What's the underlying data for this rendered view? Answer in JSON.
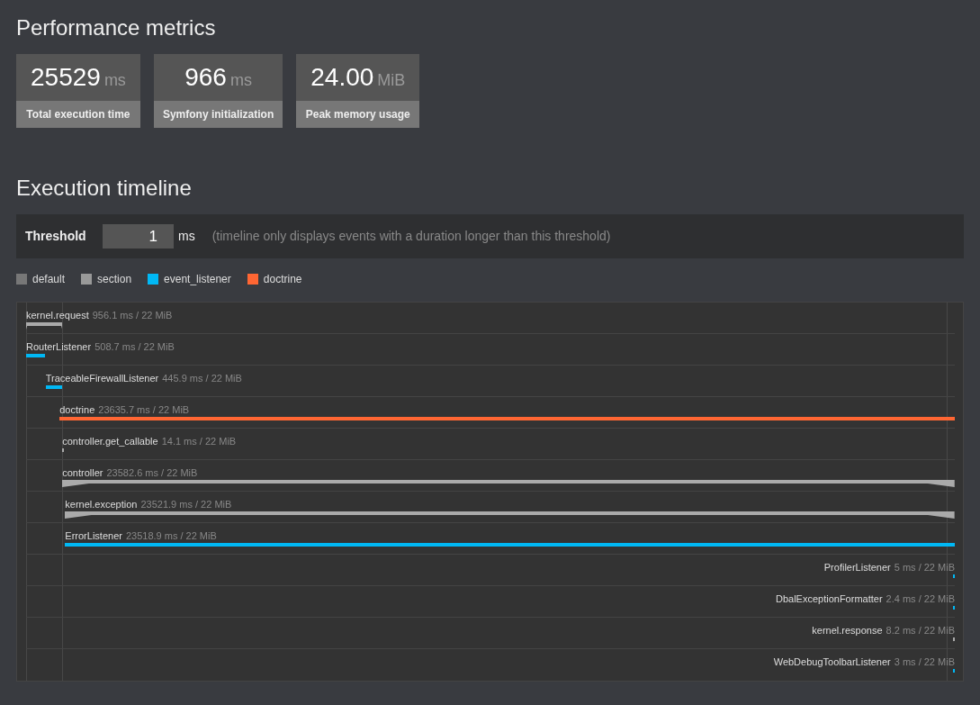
{
  "metrics_title": "Performance metrics",
  "metrics": [
    {
      "value": "25529",
      "unit": "ms",
      "label": "Total execution time"
    },
    {
      "value": "966",
      "unit": "ms",
      "label": "Symfony initialization"
    },
    {
      "value": "24.00",
      "unit": "MiB",
      "label": "Peak memory usage"
    }
  ],
  "timeline_title": "Execution timeline",
  "threshold": {
    "label": "Threshold",
    "value": "1",
    "unit": "ms",
    "hint": "(timeline only displays events with a duration longer than this threshold)"
  },
  "legend": [
    {
      "label": "default",
      "color": "#777777"
    },
    {
      "label": "section",
      "color": "#999999"
    },
    {
      "label": "event_listener",
      "color": "#00b8f5"
    },
    {
      "label": "doctrine",
      "color": "#ff6633"
    }
  ],
  "events": [
    {
      "name": "kernel.request",
      "reading": "956.1 ms / 22 MiB",
      "kind": "section"
    },
    {
      "name": "RouterListener",
      "reading": "508.7 ms / 22 MiB",
      "kind": "event_listener"
    },
    {
      "name": "TraceableFirewallListener",
      "reading": "445.9 ms / 22 MiB",
      "kind": "event_listener"
    },
    {
      "name": "doctrine",
      "reading": "23635.7 ms / 22 MiB",
      "kind": "doctrine"
    },
    {
      "name": "controller.get_callable",
      "reading": "14.1 ms / 22 MiB",
      "kind": "section"
    },
    {
      "name": "controller",
      "reading": "23582.6 ms / 22 MiB",
      "kind": "section"
    },
    {
      "name": "kernel.exception",
      "reading": "23521.9 ms / 22 MiB",
      "kind": "section"
    },
    {
      "name": "ErrorListener",
      "reading": "23518.9 ms / 22 MiB",
      "kind": "event_listener"
    },
    {
      "name": "ProfilerListener",
      "reading": "5 ms / 22 MiB",
      "kind": "event_listener"
    },
    {
      "name": "DbalExceptionFormatter",
      "reading": "2.4 ms / 22 MiB",
      "kind": "event_listener"
    },
    {
      "name": "kernel.response",
      "reading": "8.2 ms / 22 MiB",
      "kind": "section"
    },
    {
      "name": "WebDebugToolbarListener",
      "reading": "3 ms / 22 MiB",
      "kind": "event_listener"
    }
  ]
}
